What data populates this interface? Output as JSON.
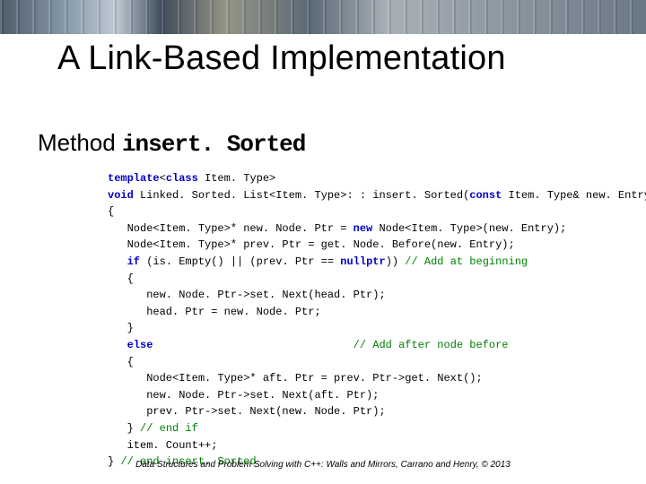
{
  "title": "A Link-Based Implementation",
  "subtitle_prefix": "Method ",
  "subtitle_code": "insert. Sorted",
  "code": {
    "l1a": "template",
    "l1b": "<",
    "l1c": "class",
    "l1d": " Item. Type> ",
    "l2a": "void",
    "l2b": " Linked. Sorted. List<Item. Type>: : insert. Sorted(",
    "l2c": "const",
    "l2d": " Item. Type& new. Entry)",
    "l3": "{",
    "l4a": "   Node<Item. Type>* new. Node. Ptr = ",
    "l4b": "new",
    "l4c": " Node<Item. Type>(new. Entry);",
    "l5": "   Node<Item. Type>* prev. Ptr = get. Node. Before(new. Entry);",
    "blank": "",
    "l6a": "   ",
    "l6b": "if",
    "l6c": " (is. Empty() || (prev. Ptr == ",
    "l6d": "nullptr",
    "l6e": ")) ",
    "l6f": "// Add at beginning",
    "l7": "   {",
    "l8": "      new. Node. Ptr->set. Next(head. Ptr);",
    "l9": "      head. Ptr = new. Node. Ptr;",
    "l10": "   }",
    "l11a": "   ",
    "l11b": "else",
    "l11pad": "                               ",
    "l11c": "// Add after node before",
    "l12": "   {",
    "l13": "      Node<Item. Type>* aft. Ptr = prev. Ptr->get. Next();",
    "l14": "      new. Node. Ptr->set. Next(aft. Ptr);",
    "l15": "      prev. Ptr->set. Next(new. Node. Ptr);",
    "l16a": "   } ",
    "l16b": "// end if",
    "l17": "   item. Count++;",
    "l18a": "} ",
    "l18b": "// end insert. Sorted"
  },
  "footer": "Data Structures and Problem Solving with C++: Walls and Mirrors, Carrano and Henry, ©  2013"
}
